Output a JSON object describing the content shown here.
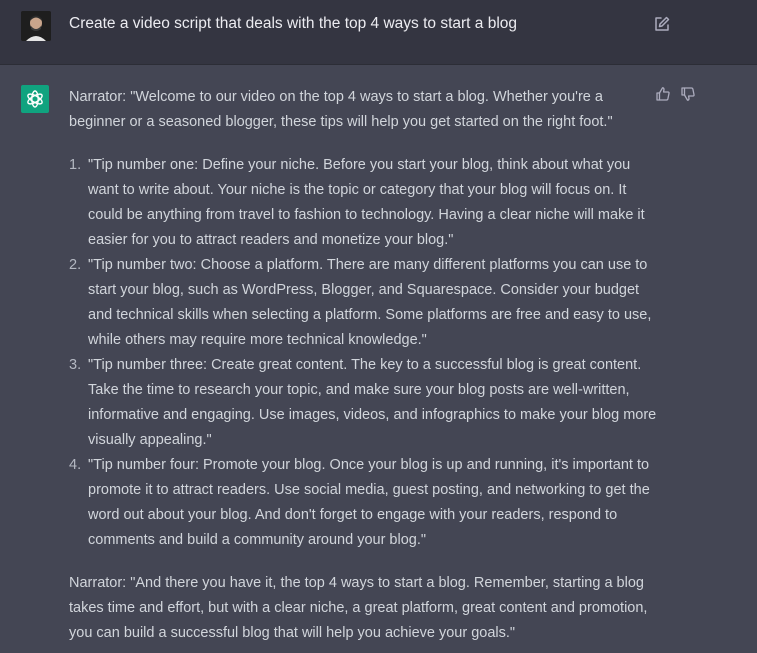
{
  "user_message": {
    "text": "Create a video script that deals with the top 4 ways to start a blog"
  },
  "assistant": {
    "intro": "Narrator: \"Welcome to our video on the top 4 ways to start a blog. Whether you're a beginner or a seasoned blogger, these tips will help you get started on the right foot.\"",
    "tips": [
      {
        "num": "1.",
        "text": "\"Tip number one: Define your niche. Before you start your blog, think about what you want to write about. Your niche is the topic or category that your blog will focus on. It could be anything from travel to fashion to technology. Having a clear niche will make it easier for you to attract readers and monetize your blog.\""
      },
      {
        "num": "2.",
        "text": "\"Tip number two: Choose a platform. There are many different platforms you can use to start your blog, such as WordPress, Blogger, and Squarespace. Consider your budget and technical skills when selecting a platform. Some platforms are free and easy to use, while others may require more technical knowledge.\""
      },
      {
        "num": "3.",
        "text": "\"Tip number three: Create great content. The key to a successful blog is great content. Take the time to research your topic, and make sure your blog posts are well-written, informative and engaging. Use images, videos, and infographics to make your blog more visually appealing.\""
      },
      {
        "num": "4.",
        "text": "\"Tip number four: Promote your blog. Once your blog is up and running, it's important to promote it to attract readers. Use social media, guest posting, and networking to get the word out about your blog. And don't forget to engage with your readers, respond to comments and build a community around your blog.\""
      }
    ],
    "outro": "Narrator: \"And there you have it, the top 4 ways to start a blog. Remember, starting a blog takes time and effort, but with a clear niche, a great platform, great content and promotion, you can build a successful blog that will help you achieve your goals.\""
  },
  "icons": {
    "user_avatar": "user-avatar-photo",
    "edit": "edit-icon",
    "bot_avatar": "openai-logo-icon",
    "thumbs_up": "thumbs-up-icon",
    "thumbs_down": "thumbs-down-icon"
  },
  "colors": {
    "user_bg": "#343541",
    "assistant_bg": "#444654",
    "bot_accent": "#10a37f",
    "text": "#d1d5db"
  }
}
